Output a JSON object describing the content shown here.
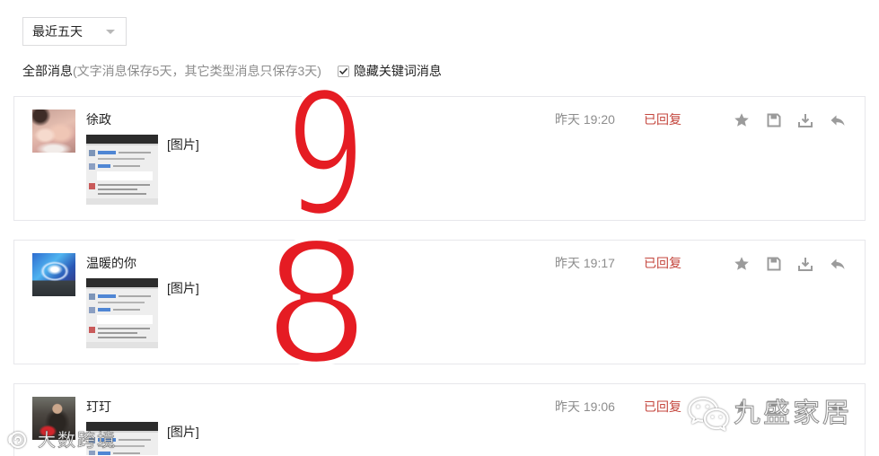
{
  "filter": {
    "range_select": "最近五天",
    "all_label": "全部消息",
    "note": "(文字消息保存5天，其它类型消息只保存3天)",
    "hide_keyword_label": "隐藏关键词消息",
    "hide_keyword_checked": true
  },
  "messages": [
    {
      "name": "徐政",
      "content": "[图片]",
      "time": "昨天 19:20",
      "status": "已回复"
    },
    {
      "name": "温暖的你",
      "content": "[图片]",
      "time": "昨天 19:17",
      "status": "已回复"
    },
    {
      "name": "玎玎",
      "content": "[图片]",
      "time": "昨天 19:06",
      "status": "已回复"
    }
  ],
  "message_actions": [
    "star-icon",
    "save-icon",
    "download-icon",
    "reply-icon"
  ],
  "annotations": [
    "9",
    "8"
  ],
  "watermarks": {
    "left": "大数跨境",
    "left_icon": "watermark-logo-icon",
    "right": "九盛家居",
    "right_icon": "wechat-icon"
  },
  "icons": {
    "range_select": "caret-down-icon",
    "checkbox": "checkmark-icon"
  },
  "colors": {
    "replied": "#c4463d",
    "annotation": "#e51c23",
    "muted_text": "#8d8d8d",
    "icon": "#9b9b9b",
    "border": "#e7e7eb"
  }
}
